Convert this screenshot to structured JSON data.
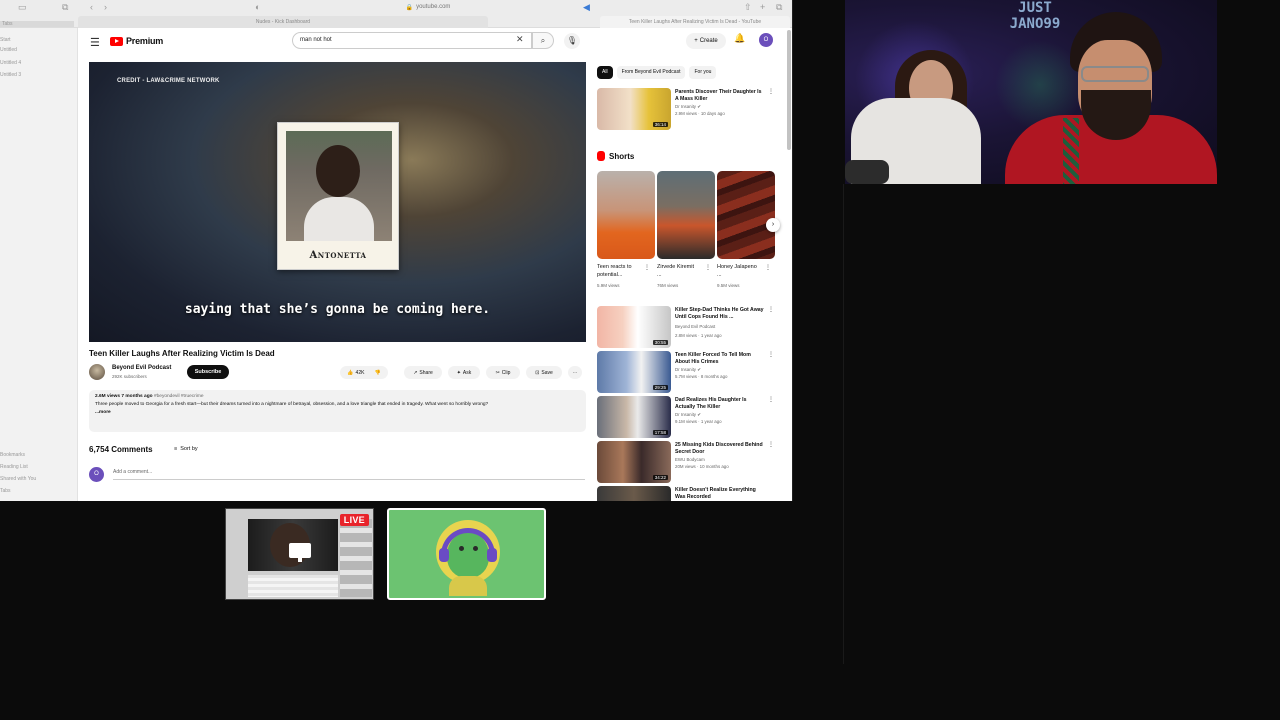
{
  "browser": {
    "url": "youtube.com",
    "tabs": [
      "Nudes - Kick Dashboard",
      "Teen Killer Laughs After Realizing Victim Is Dead - YouTube"
    ],
    "sidebar_items": [
      "Tabs",
      "Start",
      "Untitled",
      "Untitled 4",
      "Untitled 3",
      "Bookmarks",
      "Reading List",
      "Shared with You",
      "Tabs"
    ]
  },
  "youtube": {
    "logo_text": "Premium",
    "search_value": "man not hot",
    "create_label": "Create",
    "account_initial": "O",
    "icons": {
      "menu": "menu-icon",
      "search": "search-icon",
      "mic": "mic-icon",
      "bell": "bell-icon",
      "clear": "close-icon"
    },
    "player": {
      "credit": "CREDIT - LAW&CRIME NETWORK",
      "name_card": "Antonetta",
      "subtitle": "saying that she’s gonna be coming here."
    },
    "video": {
      "title": "Teen Killer Laughs After Realizing Victim Is Dead",
      "channel": "Beyond Evil Podcast",
      "subscribers": "292K subscribers",
      "subscribe_label": "Subscribe",
      "likes": "42K",
      "share_label": "Share",
      "ask_label": "Ask",
      "clip_label": "Clip",
      "save_label": "Save",
      "views_date": "2.6M views  7 months ago",
      "hashtags": "#beyondevil #truecrime",
      "description": "Three people moved to Georgia for a fresh start—but their dreams turned into a nightmare of betrayal, obsession, and a love triangle that ended in tragedy. What went so horribly wrong?",
      "more_label": "...more"
    },
    "comments": {
      "count_label": "6,754 Comments",
      "sort_label": "Sort by",
      "placeholder": "Add a comment..."
    },
    "chips": [
      "All",
      "From Beyond Evil Podcast",
      "For you"
    ],
    "top_rec": {
      "title": "Parents Discover Their Daughter Is A Mass Killer",
      "channel": "Dr Insanity",
      "meta": "2.9M views · 10 days ago",
      "duration": "36:14"
    },
    "shorts_heading": "Shorts",
    "shorts": [
      {
        "title": "Teen reacts to potential...",
        "views": "5.9M views"
      },
      {
        "title": "Zirvede Kiremit ...",
        "views": "76M views"
      },
      {
        "title": "Honey Jalapeno ...",
        "views": "9.5M views"
      }
    ],
    "recommendations": [
      {
        "title": "Killer Step-Dad Thinks He Got Away Until Cops Found His ...",
        "channel": "Beyond Evil Podcast",
        "meta": "2.8M views · 1 year ago",
        "duration": "30:55"
      },
      {
        "title": "Teen Killer Forced To Tell Mom About His Crimes",
        "channel": "Dr Insanity",
        "meta": "5.7M views · 8 months ago",
        "duration": "29:25"
      },
      {
        "title": "Dad Realizes His Daughter Is Actually The Killer",
        "channel": "Dr Insanity",
        "meta": "9.1M views · 1 year ago",
        "duration": "17:58"
      },
      {
        "title": "25 Missing Kids Discovered Behind Secret Door",
        "channel": "EWU Bodycam",
        "meta": "20M views · 10 months ago",
        "duration": "34:22"
      },
      {
        "title": "Killer Doesn't Realize Everything Was Recorded",
        "channel": "",
        "meta": "",
        "duration": ""
      }
    ]
  },
  "webcam": {
    "sign_text": "JUST JANO99"
  },
  "stream": {
    "live_badge": "LIVE"
  },
  "colors": {
    "youtube_red": "#ff0000",
    "live_red": "#e8232a",
    "tile_green": "#6cc371",
    "account_purple": "#6b4fbb"
  }
}
